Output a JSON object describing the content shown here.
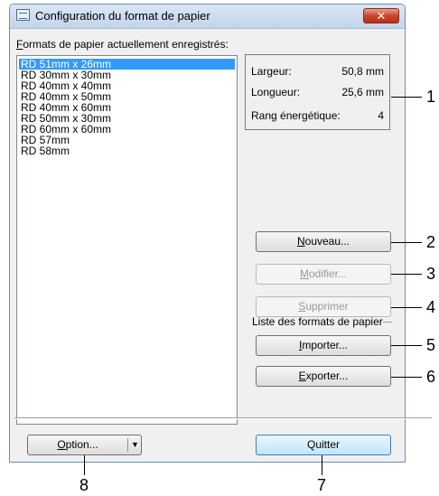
{
  "window": {
    "title": "Configuration du format de papier",
    "close_label": "✕"
  },
  "formats_label_underline": "F",
  "formats_label_rest": "ormats de papier actuellement enregistrés:",
  "formats": [
    "RD 51mm x 26mm",
    "RD 30mm x 30mm",
    "RD 40mm x 40mm",
    "RD 40mm x 50mm",
    "RD 40mm x 60mm",
    "RD 50mm x 30mm",
    "RD 60mm x 60mm",
    "RD 57mm",
    "RD 58mm"
  ],
  "selected_index": 0,
  "info": {
    "width_label": "Largeur:",
    "width_value": "50,8 mm",
    "length_label": "Longueur:",
    "length_value": "25,6 mm",
    "energy_label": "Rang énergétique:",
    "energy_value": "4"
  },
  "buttons": {
    "nouveau": {
      "underline": "N",
      "rest": "ouveau..."
    },
    "modifier": {
      "underline": "M",
      "rest": "odifier..."
    },
    "supprimer": {
      "underline": "S",
      "rest": "upprimer"
    },
    "importer": {
      "underline": "I",
      "rest": "mporter..."
    },
    "exporter": {
      "underline": "E",
      "rest": "xporter..."
    },
    "option": {
      "underline": "O",
      "rest": "ption..."
    },
    "quitter": "Quitter"
  },
  "liste_label": "Liste des formats de papier",
  "callouts": [
    "1",
    "2",
    "3",
    "4",
    "5",
    "6",
    "7",
    "8"
  ],
  "colors": {
    "selection": "#3399ff",
    "close": "#c9452a"
  }
}
